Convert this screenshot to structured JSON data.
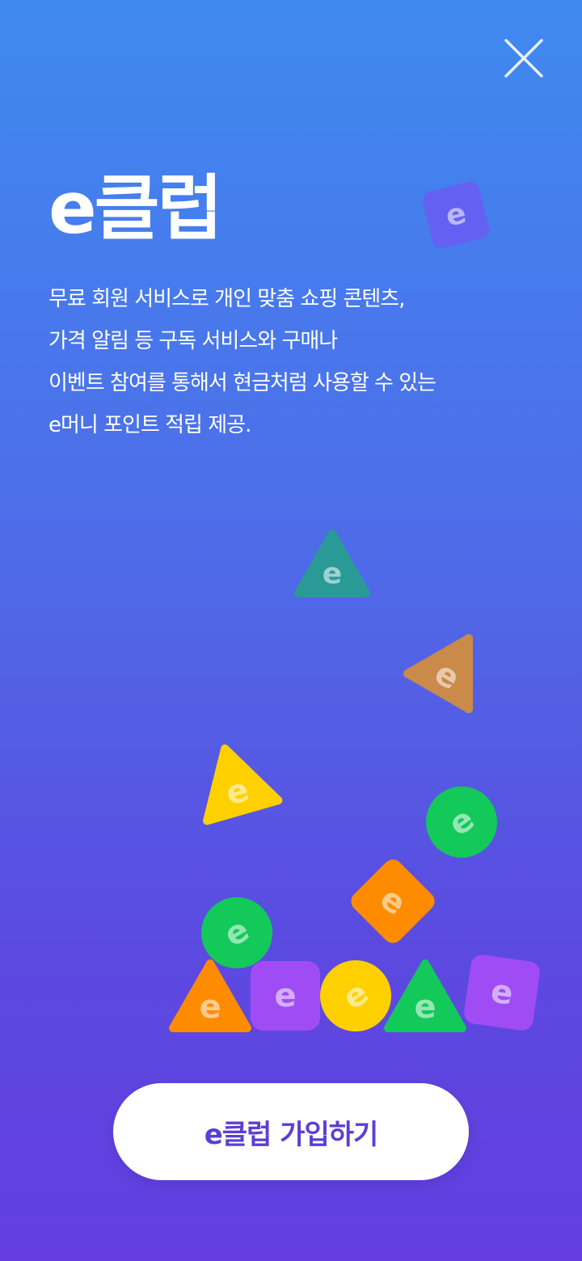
{
  "header": {
    "close_icon": "close-icon"
  },
  "hero": {
    "title": "e클럽",
    "description_lines": [
      "무료 회원 서비스로 개인 맞춤 쇼핑 콘텐츠,",
      "가격 알림 등 구독 서비스와 구매나",
      "이벤트 참여를 통해서 현금처럼 사용할 수 있는",
      "e머니 포인트 적립 제공."
    ]
  },
  "illustration": {
    "coin_letter": "e",
    "colors": {
      "purple": "#a04cf5",
      "green": "#13c95a",
      "orange": "#ff8c00",
      "yellow": "#ffd000",
      "teal": "#2a9a96",
      "brown": "#c98a4a"
    }
  },
  "footer": {
    "join_label": "e클럽 가입하기"
  }
}
